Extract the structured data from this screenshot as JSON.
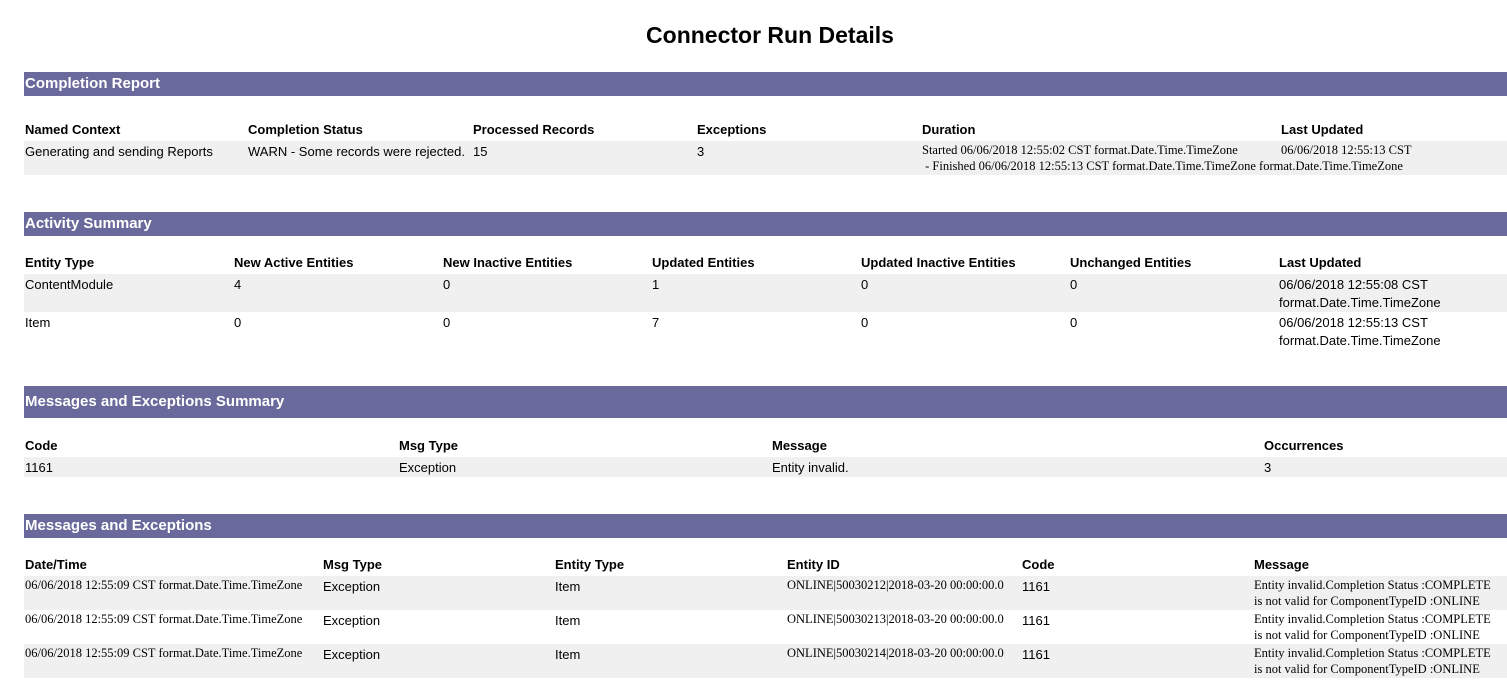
{
  "title": "Connector Run Details",
  "colors": {
    "section_bar": "#696a9b",
    "row_shade": "#f0f0f0"
  },
  "completion_report": {
    "heading": "Completion Report",
    "columns": [
      "Named Context",
      "Completion Status",
      "Processed Records",
      "Exceptions",
      "Duration",
      "Last Updated"
    ],
    "row": {
      "named_context": "Generating and sending Reports",
      "status": "WARN - Some records were rejected.",
      "processed": "15",
      "exceptions": "3",
      "duration_line1": "Started 06/06/2018 12:55:02 CST format.Date.Time.TimeZone",
      "duration_line2": " - Finished 06/06/2018 12:55:13 CST format.Date.Time.TimeZone format.Date.Time.TimeZone",
      "last_updated": "06/06/2018 12:55:13 CST"
    }
  },
  "activity_summary": {
    "heading": "Activity Summary",
    "columns": [
      "Entity Type",
      "New Active Entities",
      "New Inactive Entities",
      "Updated Entities",
      "Updated Inactive Entities",
      "Unchanged Entities",
      "Last Updated"
    ],
    "rows": [
      {
        "entity_type": "ContentModule",
        "new_active": "4",
        "new_inactive": "0",
        "updated": "1",
        "updated_inactive": "0",
        "unchanged": "0",
        "last_updated_1": "06/06/2018 12:55:08 CST",
        "last_updated_2": "format.Date.Time.TimeZone"
      },
      {
        "entity_type": "Item",
        "new_active": "0",
        "new_inactive": "0",
        "updated": "7",
        "updated_inactive": "0",
        "unchanged": "0",
        "last_updated_1": "06/06/2018 12:55:13 CST",
        "last_updated_2": "format.Date.Time.TimeZone"
      }
    ]
  },
  "messages_summary": {
    "heading": "Messages and Exceptions Summary",
    "columns": [
      "Code",
      "Msg Type",
      "Message",
      "Occurrences"
    ],
    "rows": [
      {
        "code": "1161",
        "msg_type": "Exception",
        "message": "Entity invalid.",
        "occurrences": "3"
      }
    ]
  },
  "messages": {
    "heading": "Messages and Exceptions",
    "columns": [
      "Date/Time",
      "Msg Type",
      "Entity Type",
      "Entity ID",
      "Code",
      "Message"
    ],
    "rows": [
      {
        "datetime": "06/06/2018 12:55:09 CST format.Date.Time.TimeZone",
        "msg_type": "Exception",
        "entity_type": "Item",
        "entity_id": "ONLINE|50030212|2018-03-20 00:00:00.0",
        "code": "1161",
        "message_1": "Entity invalid.Completion Status :COMPLETE",
        "message_2": "is not valid for ComponentTypeID :ONLINE"
      },
      {
        "datetime": "06/06/2018 12:55:09 CST format.Date.Time.TimeZone",
        "msg_type": "Exception",
        "entity_type": "Item",
        "entity_id": "ONLINE|50030213|2018-03-20 00:00:00.0",
        "code": "1161",
        "message_1": "Entity invalid.Completion Status :COMPLETE",
        "message_2": "is not valid for ComponentTypeID :ONLINE"
      },
      {
        "datetime": "06/06/2018 12:55:09 CST format.Date.Time.TimeZone",
        "msg_type": "Exception",
        "entity_type": "Item",
        "entity_id": "ONLINE|50030214|2018-03-20 00:00:00.0",
        "code": "1161",
        "message_1": "Entity invalid.Completion Status :COMPLETE",
        "message_2": "is not valid for ComponentTypeID :ONLINE"
      }
    ]
  }
}
